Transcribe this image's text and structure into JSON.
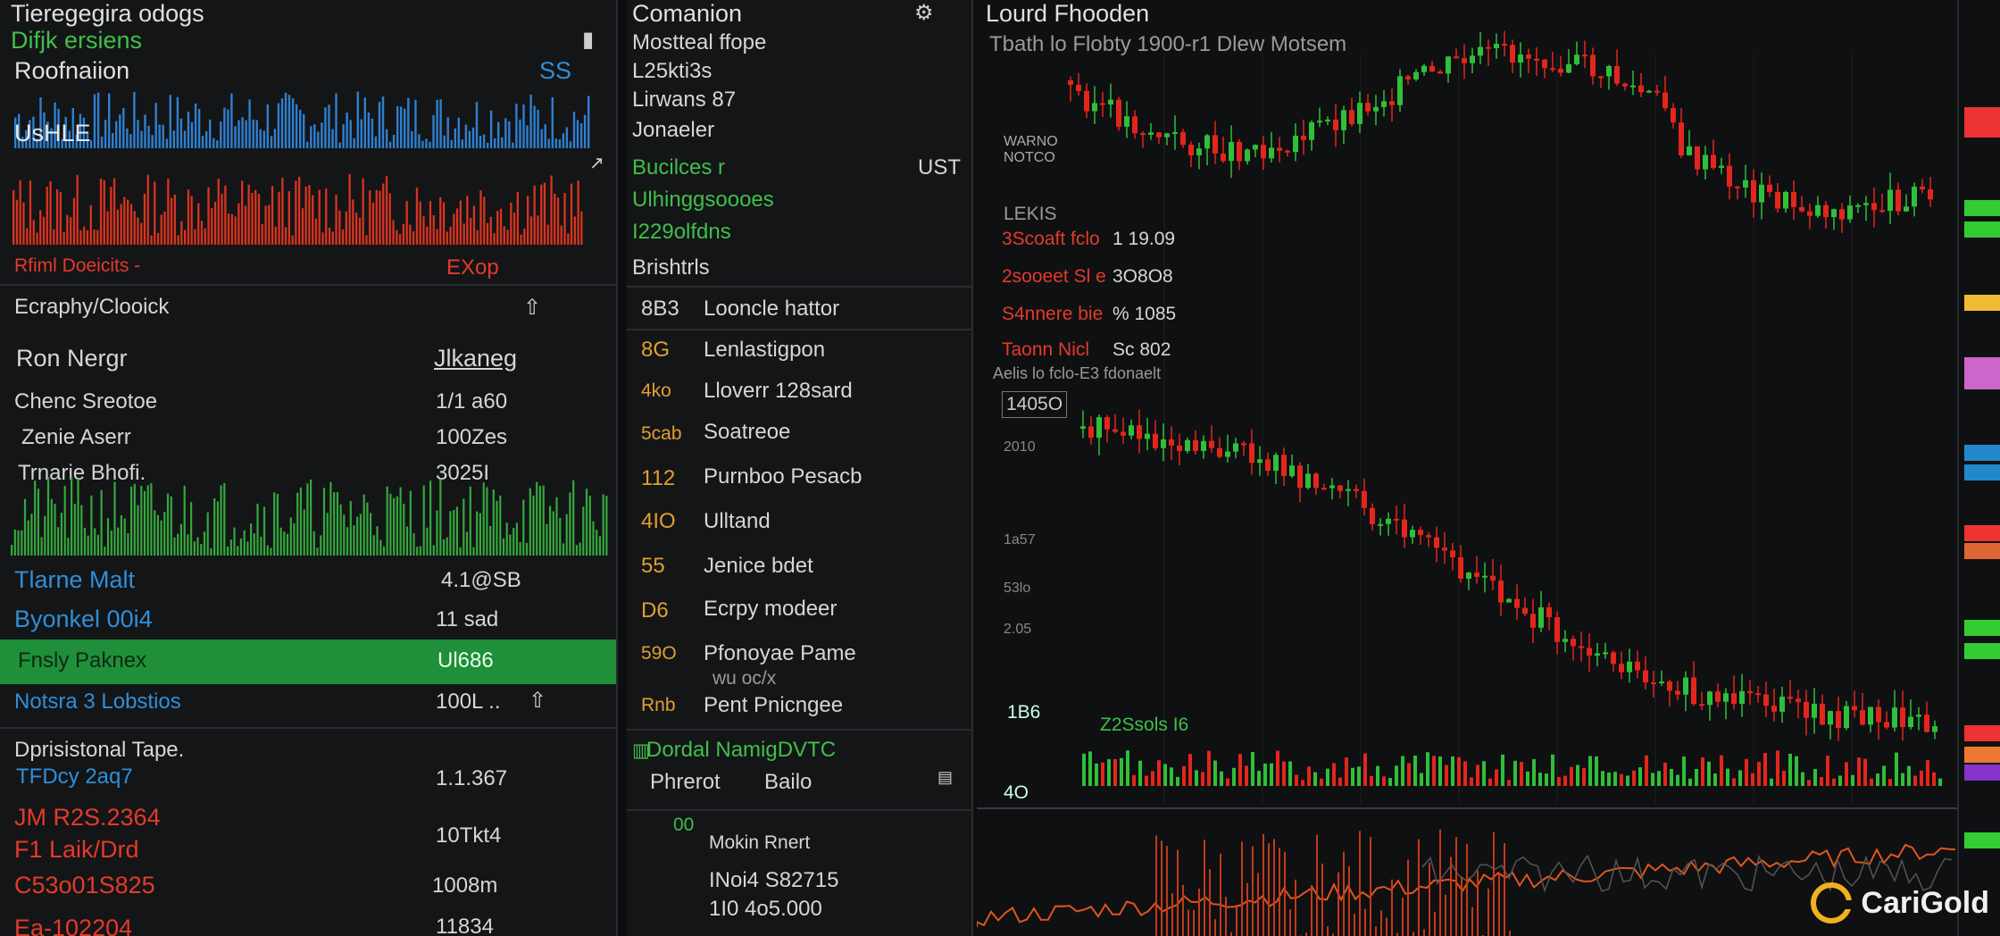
{
  "left": {
    "title": "Tieregegira odogs",
    "subtitle": "Difjk ersiens",
    "subtitle_icon": "page-icon",
    "section1_label": "Roofnaiion",
    "section1_value": "SS",
    "section2_label": "UsHLE",
    "section2_sub": "Rfiml Doeicits -",
    "section2_sub_value": "EXop",
    "section3_label": "Ecraphy/Clooick",
    "table_header_label": "Ron Nergr",
    "table_header_value": "Jlkaneg",
    "rows1": [
      {
        "label": "Chenc Sreotoe",
        "value": "1/1 a60"
      },
      {
        "label": "Zenie Aserr",
        "value": "100Zes"
      },
      {
        "label": "Trnarie Bhofi.",
        "value": "3025I"
      }
    ],
    "rows2": [
      {
        "label": "Tlarne Malt",
        "value": "4.1@SB"
      },
      {
        "label": "Byonkel 00i4",
        "value": "11 sad"
      },
      {
        "label": "Fnsly Paknex",
        "value": "Ul686"
      },
      {
        "label": "Notsra 3 Lobstios",
        "value": "100L .."
      }
    ],
    "section4_title": "Dprisistonal Tape.",
    "rows3": [
      {
        "label": "TFDcy 2aq7",
        "value": "1.1.367"
      },
      {
        "label": "JM R2S.2364",
        "value": "10Tkt4"
      },
      {
        "label": "F1 Laik/Drd",
        "value": ""
      },
      {
        "label": "C53o01S825",
        "value": "1008m"
      },
      {
        "label": "Ea-102204",
        "value": "11834"
      }
    ]
  },
  "mid": {
    "title": "Comanion",
    "title_icon": "settings-icon",
    "info": [
      "Mostteal ffope",
      "L25kti3s",
      "Lirwans 87",
      "Jonaeler"
    ],
    "green_label": "Bucilces r",
    "green_value": "UST",
    "green_lines": [
      "Ulhinggsoooes",
      "I229olfdns"
    ],
    "section_title": "Brishtrls",
    "list": [
      {
        "code": "8B3",
        "name": "Looncle hattor"
      },
      {
        "code": "8G",
        "name": "Lenlastigpon"
      },
      {
        "code": "4ko",
        "name": "Lloverr 128sard"
      },
      {
        "code": "5cab",
        "name": "Soatreoe"
      },
      {
        "code": "112",
        "name": "Purnboo Pesacb"
      },
      {
        "code": "4IO",
        "name": "Ulltand"
      },
      {
        "code": "55",
        "name": "Jenice bdet"
      },
      {
        "code": "D6",
        "name": "Ecrpy modeer"
      },
      {
        "code": "59O",
        "name": "Pfonoyae Pame"
      },
      {
        "code": "Rnb",
        "name": "Pent Pnicngee"
      }
    ],
    "list_sub": "wu oc/x",
    "footer_title": "Dordal NamigDVTC",
    "footer_sub": "Phrerot",
    "footer_sub_value": "Bailo",
    "bottom_label": "Mokin Rnert",
    "bottom_code": "00",
    "bottom_values": [
      "INoi4 S82715",
      "1I0 4o5.000"
    ]
  },
  "right": {
    "title": "Lourd Fhooden",
    "subtitle": "Tbath lo Flobty 1900-r1 Dlew Motsem",
    "axis_label_1": "WARNO",
    "axis_label_2": "NOTCO",
    "section_label": "LEKIS",
    "stats": [
      {
        "label": "3Scoaft fclo",
        "value": "1 19.09"
      },
      {
        "label": "2sooeet Sl e",
        "value": "3O8O8"
      },
      {
        "label": "S4nnere bie",
        "value": "% 1085"
      },
      {
        "label": "Taonn Nicl",
        "value": "Sc 802"
      }
    ],
    "note": "Aelis lo fclo-E3 fdonaelt",
    "price_tag": "1405O",
    "y_ticks": [
      "2010",
      "1a57",
      "53lo",
      "2.05"
    ],
    "volume_label": "1B6",
    "volume_tag": "Z2Ssols I6",
    "bottom_tick": "4O",
    "brand": "CariGold",
    "brand_icon": "carigold-logo-icon",
    "colors": {
      "up": "#2fbf3a",
      "down": "#e3261c",
      "accent": "#f2b01e",
      "highlight": "#1f8f3a"
    }
  }
}
